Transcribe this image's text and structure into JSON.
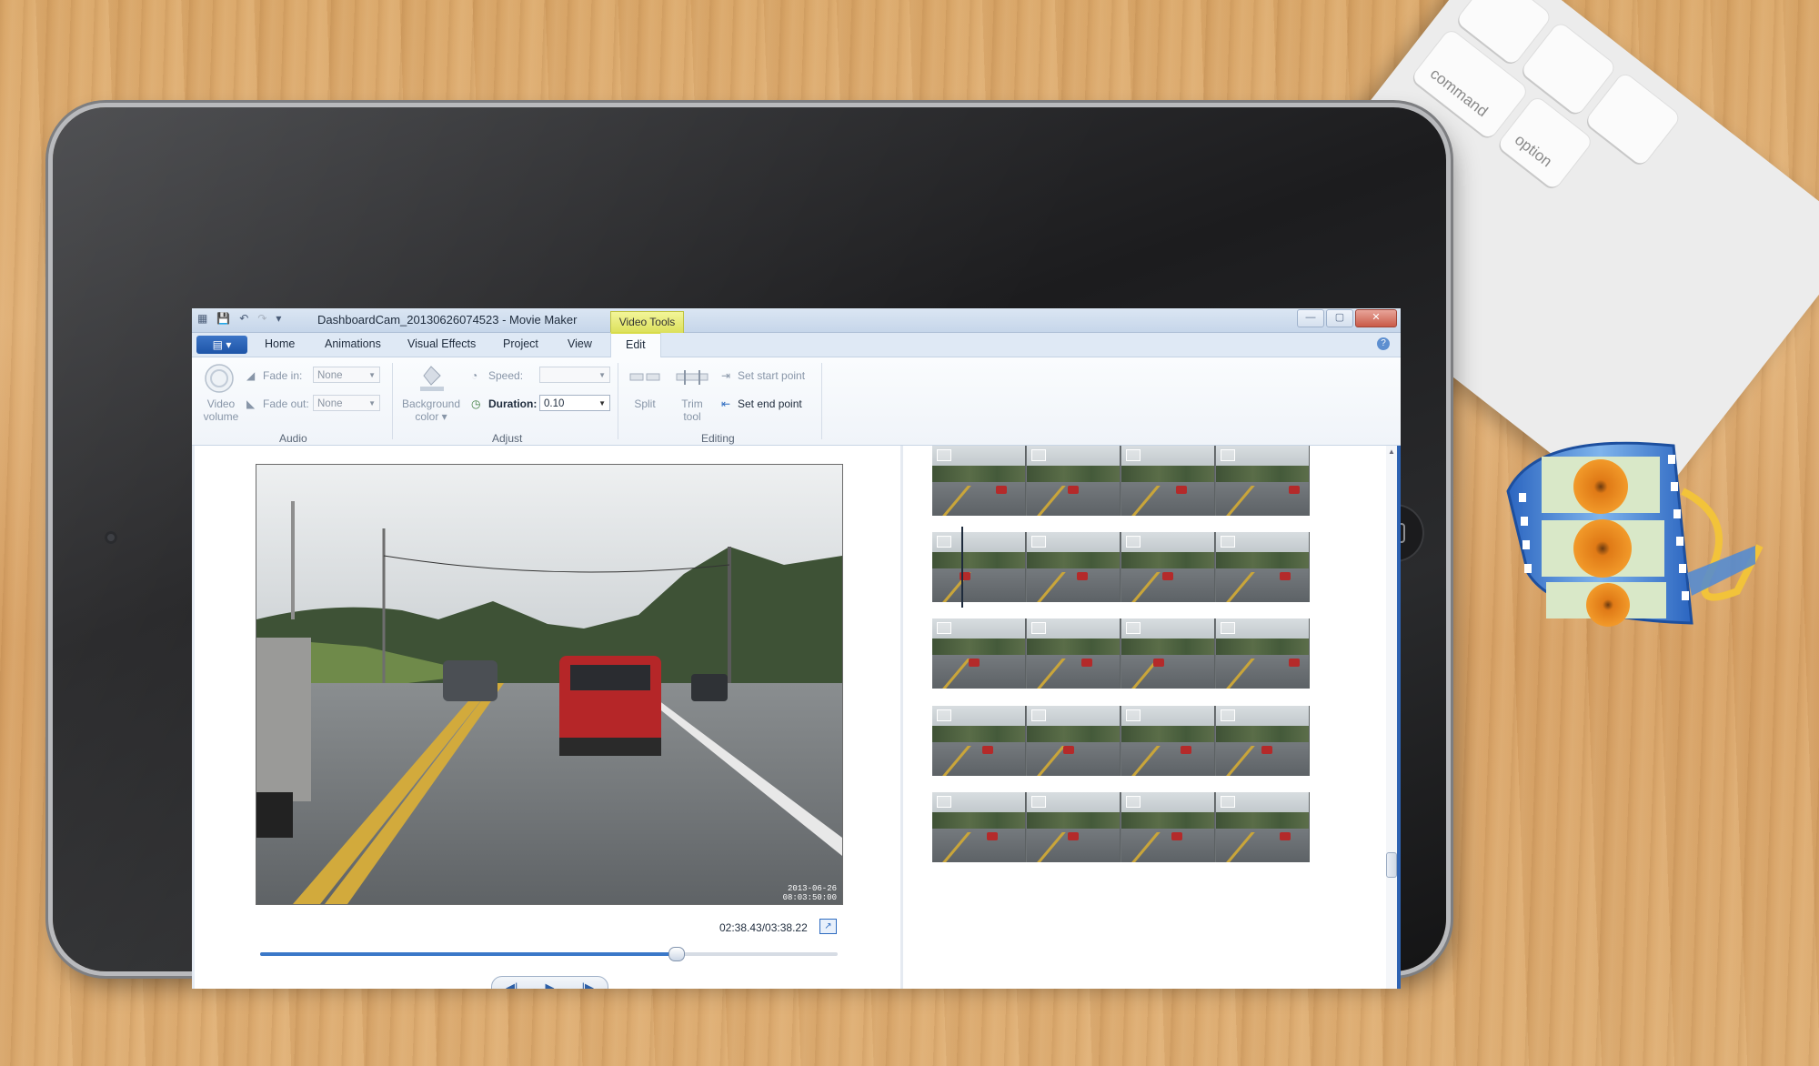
{
  "window": {
    "title": "DashboardCam_20130626074523 - Movie Maker",
    "contextual_tab": "Video Tools",
    "minimize": "—",
    "maximize": "▢",
    "close": "✕"
  },
  "ribbon_tabs": {
    "file": "▤ ▾",
    "home": "Home",
    "animations": "Animations",
    "visual_effects": "Visual Effects",
    "project": "Project",
    "view": "View",
    "edit": "Edit",
    "help": "?"
  },
  "ribbon": {
    "audio": {
      "video_volume": [
        "Video",
        "volume"
      ],
      "fade_in_label": "Fade in:",
      "fade_in_value": "None",
      "fade_out_label": "Fade out:",
      "fade_out_value": "None",
      "group": "Audio"
    },
    "adjust": {
      "background_color": [
        "Background",
        "color"
      ],
      "speed_label": "Speed:",
      "speed_value": "",
      "duration_label": "Duration:",
      "duration_value": "0.10",
      "group": "Adjust"
    },
    "editing": {
      "split": "Split",
      "trim_tool": [
        "Trim",
        "tool"
      ],
      "set_start_point": "Set start point",
      "set_end_point": "Set end point",
      "group": "Editing"
    }
  },
  "preview": {
    "time": "02:38.43/03:38.22",
    "timestamp_line1": "2013-06-26",
    "timestamp_line2": "08:03:50:00",
    "seek_fraction": 0.72,
    "controls": {
      "prev": "◀|",
      "play": "▶",
      "next": "|▶"
    }
  },
  "storyboard": {
    "rows": 5,
    "selected_row": 2,
    "selected_frame": 1
  },
  "colors": {
    "accent": "#3b78c8",
    "context_tab": "#dce05a",
    "selected_frame": "#7fb6ec"
  }
}
